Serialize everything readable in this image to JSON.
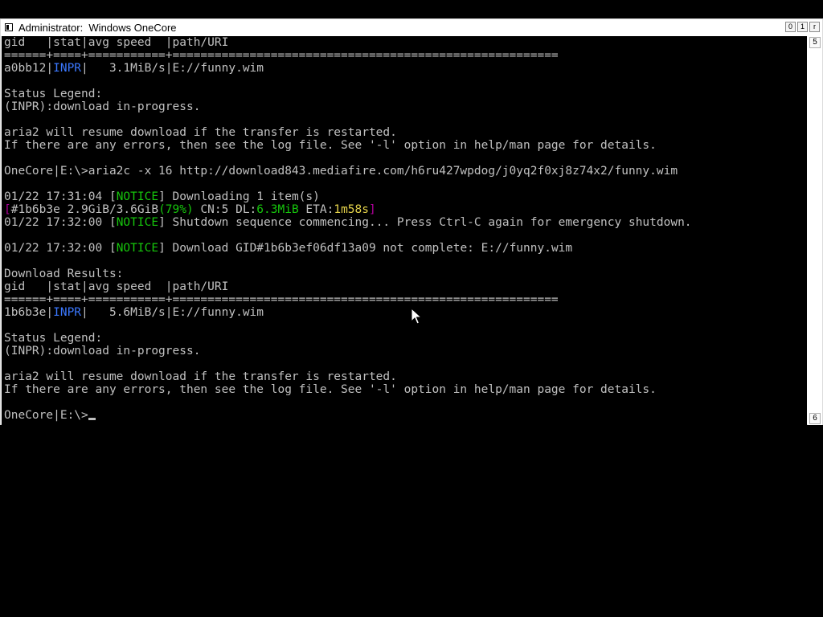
{
  "window": {
    "title": "Administrator:  Windows OneCore",
    "buttons": {
      "minimize": "0",
      "maximize": "1",
      "close": "r"
    },
    "scroll": {
      "up": "5",
      "down": "6"
    }
  },
  "console": {
    "lines": [
      [
        {
          "t": "gid   |stat|avg speed  |path/URI"
        }
      ],
      [
        {
          "t": "======+====+===========+======================================================="
        }
      ],
      [
        {
          "t": "a0bb12|"
        },
        {
          "t": "INPR",
          "c": "blue"
        },
        {
          "t": "|   3.1MiB/s|E://funny.wim"
        }
      ],
      [
        {
          "t": ""
        }
      ],
      [
        {
          "t": "Status Legend:"
        }
      ],
      [
        {
          "t": "(INPR):download in-progress."
        }
      ],
      [
        {
          "t": ""
        }
      ],
      [
        {
          "t": "aria2 will resume download if the transfer is restarted."
        }
      ],
      [
        {
          "t": "If there are any errors, then see the log file. See '-l' option in help/man page for details."
        }
      ],
      [
        {
          "t": ""
        }
      ],
      [
        {
          "t": "OneCore|E:\\>aria2c -x 16 http://download843.mediafire.com/h6ru427wpdog/j0yq2f0xj8z74x2/funny.wim"
        }
      ],
      [
        {
          "t": ""
        }
      ],
      [
        {
          "t": "01/22 17:31:04 ["
        },
        {
          "t": "NOTICE",
          "c": "green"
        },
        {
          "t": "] Downloading 1 item(s)"
        }
      ],
      [
        {
          "t": "[",
          "c": "magenta"
        },
        {
          "t": "#1b6b3e 2.9GiB/3.6GiB"
        },
        {
          "t": "(79%)",
          "c": "green"
        },
        {
          "t": " CN:5 DL:"
        },
        {
          "t": "6.3MiB",
          "c": "green"
        },
        {
          "t": " ETA:"
        },
        {
          "t": "1m58s",
          "c": "yellow"
        },
        {
          "t": "]",
          "c": "magenta"
        }
      ],
      [
        {
          "t": "01/22 17:32:00 ["
        },
        {
          "t": "NOTICE",
          "c": "green"
        },
        {
          "t": "] Shutdown sequence commencing... Press Ctrl-C again for emergency shutdown."
        }
      ],
      [
        {
          "t": ""
        }
      ],
      [
        {
          "t": "01/22 17:32:00 ["
        },
        {
          "t": "NOTICE",
          "c": "green"
        },
        {
          "t": "] Download GID#1b6b3ef06df13a09 not complete: E://funny.wim"
        }
      ],
      [
        {
          "t": ""
        }
      ],
      [
        {
          "t": "Download Results:"
        }
      ],
      [
        {
          "t": "gid   |stat|avg speed  |path/URI"
        }
      ],
      [
        {
          "t": "======+====+===========+======================================================="
        }
      ],
      [
        {
          "t": "1b6b3e|"
        },
        {
          "t": "INPR",
          "c": "blue"
        },
        {
          "t": "|   5.6MiB/s|E://funny.wim"
        }
      ],
      [
        {
          "t": ""
        }
      ],
      [
        {
          "t": "Status Legend:"
        }
      ],
      [
        {
          "t": "(INPR):download in-progress."
        }
      ],
      [
        {
          "t": ""
        }
      ],
      [
        {
          "t": "aria2 will resume download if the transfer is restarted."
        }
      ],
      [
        {
          "t": "If there are any errors, then see the log file. See '-l' option in help/man page for details."
        }
      ],
      [
        {
          "t": ""
        }
      ],
      [
        {
          "t": "OneCore|E:\\>"
        }
      ]
    ]
  },
  "colors": {
    "background": "#000000",
    "text": "#c0c0c0",
    "blue": "#3b78ff",
    "green": "#16c60c",
    "magenta": "#b4009e",
    "yellow": "#e5d34a"
  }
}
